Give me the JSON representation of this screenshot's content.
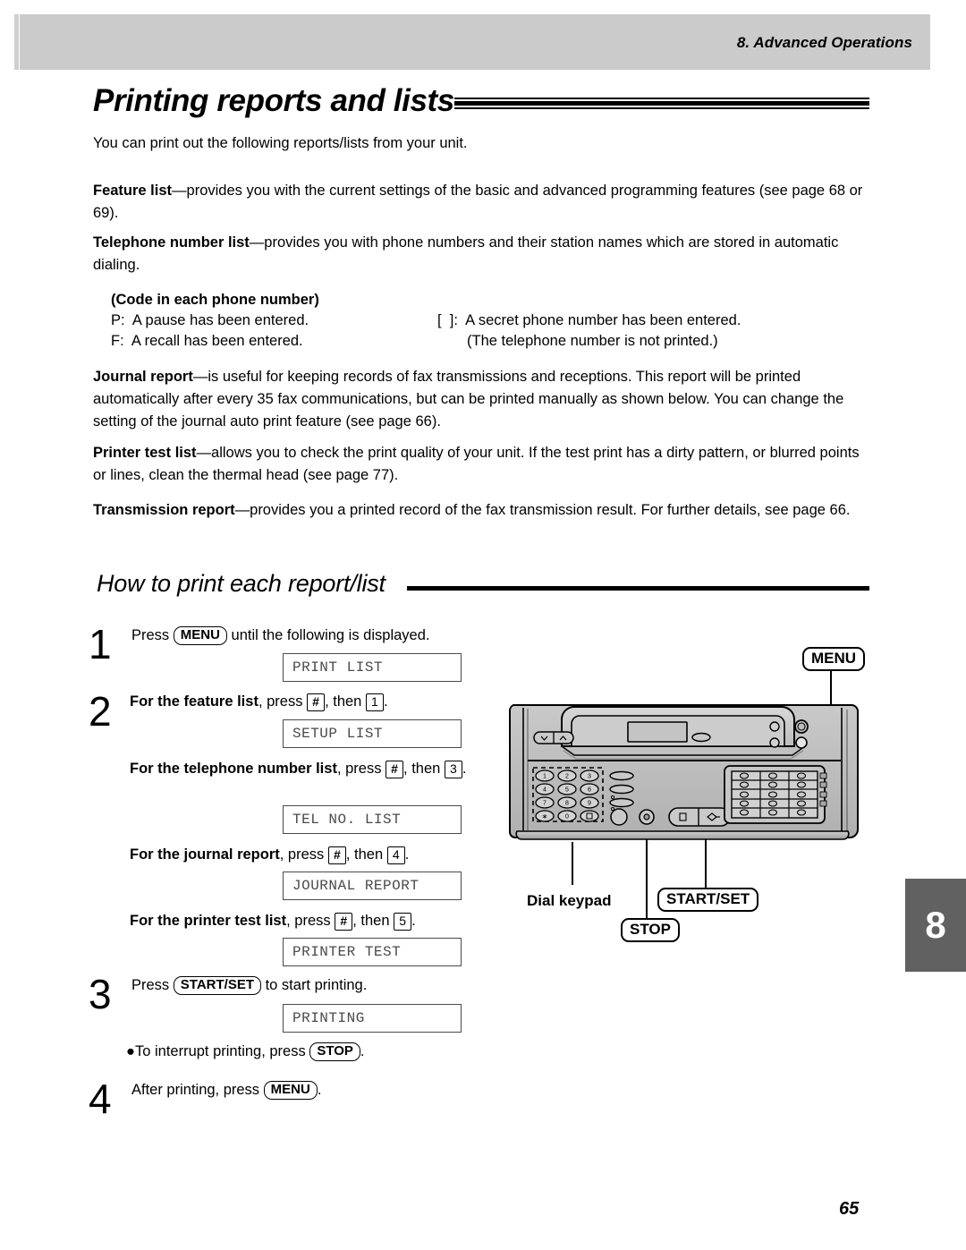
{
  "header": {
    "chapter_label": "8.  Advanced Operations"
  },
  "title": "Printing reports and lists",
  "intro": "You can print out the following reports/lists from your unit.",
  "definitions": [
    {
      "term": "Feature list",
      "body": "—provides you with the current settings of the basic and advanced programming features (see page 68 or 69)."
    },
    {
      "term": "Telephone number list",
      "body": "—provides you with phone numbers and their station names which are stored in automatic dialing."
    },
    {
      "term": "Journal report",
      "body": "—is useful for keeping records of fax transmissions and receptions. This report will be printed automatically after every 35 fax communications, but can be printed manually as shown below. You can change the setting of the journal auto print feature (see page 66)."
    },
    {
      "term": "Printer test list",
      "body": "—allows you to check the print quality of your unit. If the test print has a dirty pattern, or blurred points or lines, clean the thermal head (see page 77)."
    },
    {
      "term": "Transmission report",
      "body": "—provides you a printed record of the fax transmission result. For further details, see page 66."
    }
  ],
  "code_block": {
    "heading": "(Code in each phone number)",
    "left": [
      "P:  A pause has been entered.",
      "F:  A recall has been entered."
    ],
    "right": [
      "[  ]:  A secret phone number has been entered.",
      "(The telephone number is not printed.)"
    ]
  },
  "subtitle": "How to print each report/list",
  "steps": {
    "one": {
      "number": "1",
      "text_before": "Press ",
      "key": "MENU",
      "text_after": " until the following is displayed.",
      "lcd": "PRINT LIST"
    },
    "two": {
      "number": "2",
      "items": [
        {
          "label": "For the feature list",
          "mid": ", press ",
          "key1": "#",
          "mid2": ", then ",
          "key2": "1",
          "end": ".",
          "lcd": "SETUP LIST"
        },
        {
          "label": "For the telephone number list",
          "mid": ", press ",
          "key1": "#",
          "mid2": ", then ",
          "key2": "3",
          "end": ".",
          "lcd": "TEL NO. LIST"
        },
        {
          "label": "For the journal report",
          "mid": ", press ",
          "key1": "#",
          "mid2": ", then ",
          "key2": "4",
          "end": ".",
          "lcd": "JOURNAL REPORT"
        },
        {
          "label": "For the printer test list",
          "mid": ", press ",
          "key1": "#",
          "mid2": ", then ",
          "key2": "5",
          "end": ".",
          "lcd": "PRINTER TEST"
        }
      ]
    },
    "three": {
      "number": "3",
      "text_before": "Press ",
      "key": "START/SET",
      "text_after": " to start printing.",
      "lcd": "PRINTING",
      "bullet_before": "●To interrupt printing, press ",
      "bullet_key": "STOP",
      "bullet_after": "."
    },
    "four": {
      "number": "4",
      "text_before": "After printing, press ",
      "key": "MENU",
      "text_after": "."
    }
  },
  "illustration": {
    "callouts": {
      "menu": "MENU",
      "dial_keypad": "Dial keypad",
      "start_set": "START/SET",
      "stop": "STOP"
    },
    "keypad_keys": [
      "1",
      "2",
      "3",
      "4",
      "5",
      "6",
      "7",
      "8",
      "9",
      "∗",
      "0",
      "□"
    ]
  },
  "chapter_tab": "8",
  "page_number": "65",
  "colors": {
    "header_bar": "#cbcbcb",
    "chapter_tab": "#616161",
    "lcd_text": "#4a4a4a",
    "body_text": "#000000"
  }
}
